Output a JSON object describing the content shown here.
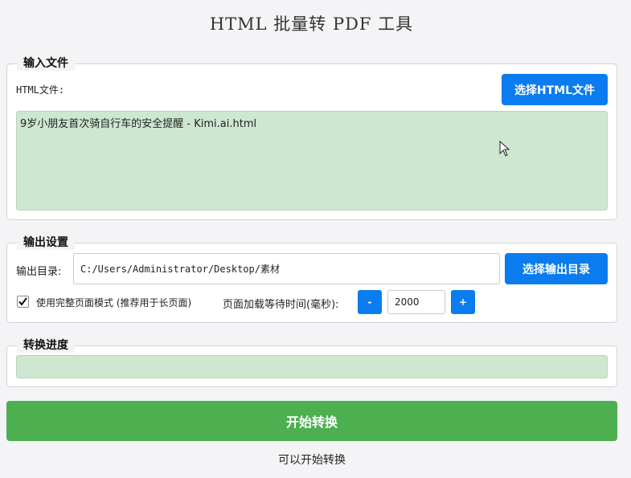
{
  "title": "HTML 批量转 PDF 工具",
  "input_group": {
    "title": "输入文件",
    "html_label": "HTML文件:",
    "select_button": "选择HTML文件",
    "files": [
      "9岁小朋友首次骑自行车的安全提醒 - Kimi.ai.html"
    ]
  },
  "output_group": {
    "title": "输出设置",
    "dir_label": "输出目录:",
    "dir_value": "C:/Users/Administrator/Desktop/素材",
    "select_dir_button": "选择输出目录",
    "fullpage_checked": true,
    "fullpage_label": "使用完整页面模式 (推荐用于长页面)",
    "wait_label": "页面加载等待时间(毫秒):",
    "wait_value": "2000",
    "decrement_label": "-",
    "increment_label": "+"
  },
  "progress_group": {
    "title": "转换进度",
    "progress_percent": 0
  },
  "start_button": "开始转换",
  "status_text": "可以开始转换",
  "colors": {
    "accent_blue": "#0a7cf0",
    "accent_green": "#4caf50",
    "list_bg": "#cde7d0"
  }
}
